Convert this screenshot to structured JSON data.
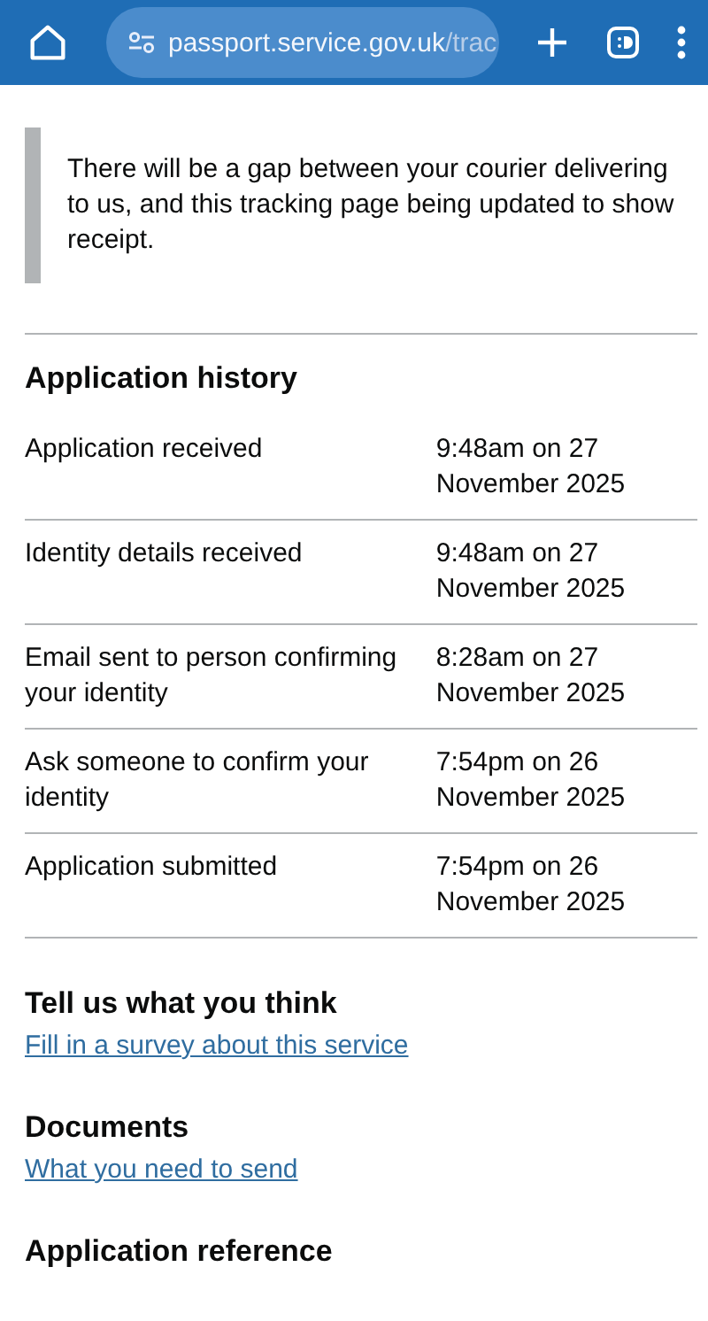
{
  "browser": {
    "url_host": "passport.service.gov.uk",
    "url_path": "/trac"
  },
  "inset_text": "There will be a gap between your courier delivering to us, and this tracking page being updated to show receipt.",
  "history": {
    "title": "Application history",
    "rows": [
      {
        "event": "Application received",
        "time": "9:48am on 27 November 2025"
      },
      {
        "event": "Identity details received",
        "time": "9:48am on 27 November 2025"
      },
      {
        "event": "Email sent to person confirming your identity",
        "time": "8:28am on 27 November 2025"
      },
      {
        "event": "Ask someone to confirm your identity",
        "time": "7:54pm on 26 November 2025"
      },
      {
        "event": "Application submitted",
        "time": "7:54pm on 26 November 2025"
      }
    ]
  },
  "sections": [
    {
      "title": "Tell us what you think",
      "link": "Fill in a survey about this service"
    },
    {
      "title": "Documents",
      "link": "What you need to send"
    },
    {
      "title": "Application reference"
    }
  ]
}
